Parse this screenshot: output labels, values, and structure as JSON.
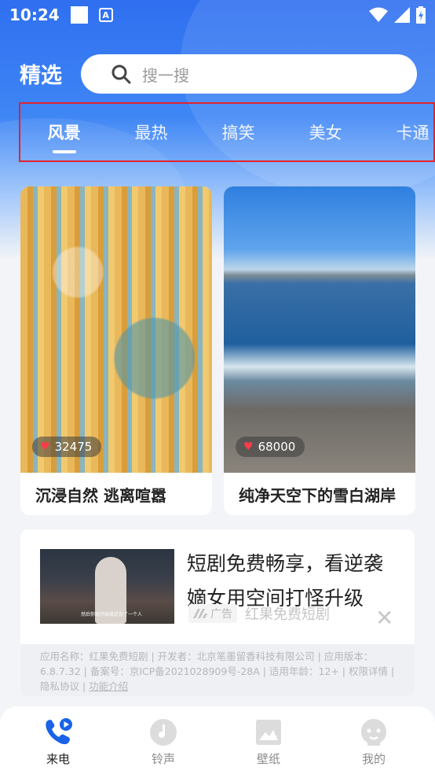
{
  "status_bar": {
    "time": "10:24"
  },
  "header": {
    "title": "精选",
    "search_placeholder": "搜一搜"
  },
  "tabs": [
    {
      "label": "风景",
      "active": true
    },
    {
      "label": "最热",
      "active": false
    },
    {
      "label": "搞笑",
      "active": false
    },
    {
      "label": "美女",
      "active": false
    },
    {
      "label": "卡通",
      "active": false
    }
  ],
  "cards": [
    {
      "likes": "32475",
      "caption": "沉浸自然 逃离喧嚣"
    },
    {
      "likes": "68000",
      "caption": "纯净天空下的雪白湖岸"
    }
  ],
  "ad": {
    "headline": "短剧免费畅享，看逆袭嫡女用空间打怪升级",
    "tag": "广告",
    "brand": "红果免费短剧",
    "thumb_subtitle": "然后你就开始接近你了一个人",
    "info_text": "应用名称：红果免费短剧 | 开发者：北京笔墨留香科技有限公司 | 应用版本：6.8.7.32 | 备案号：京ICP备2021028909号-28A | 适用年龄：12+ | 权限详情 | 隐私协议 | ",
    "info_link": "功能介绍"
  },
  "bottom_nav": [
    {
      "label": "来电",
      "icon": "phone-icon",
      "active": true
    },
    {
      "label": "铃声",
      "icon": "music-disc-icon",
      "active": false
    },
    {
      "label": "壁纸",
      "icon": "wallpaper-icon",
      "active": false
    },
    {
      "label": "我的",
      "icon": "profile-icon",
      "active": false
    }
  ],
  "colors": {
    "primary_blue": "#2f6ff0",
    "tab_highlight_border": "#e0232f",
    "heart_red": "#ff3b4b"
  }
}
